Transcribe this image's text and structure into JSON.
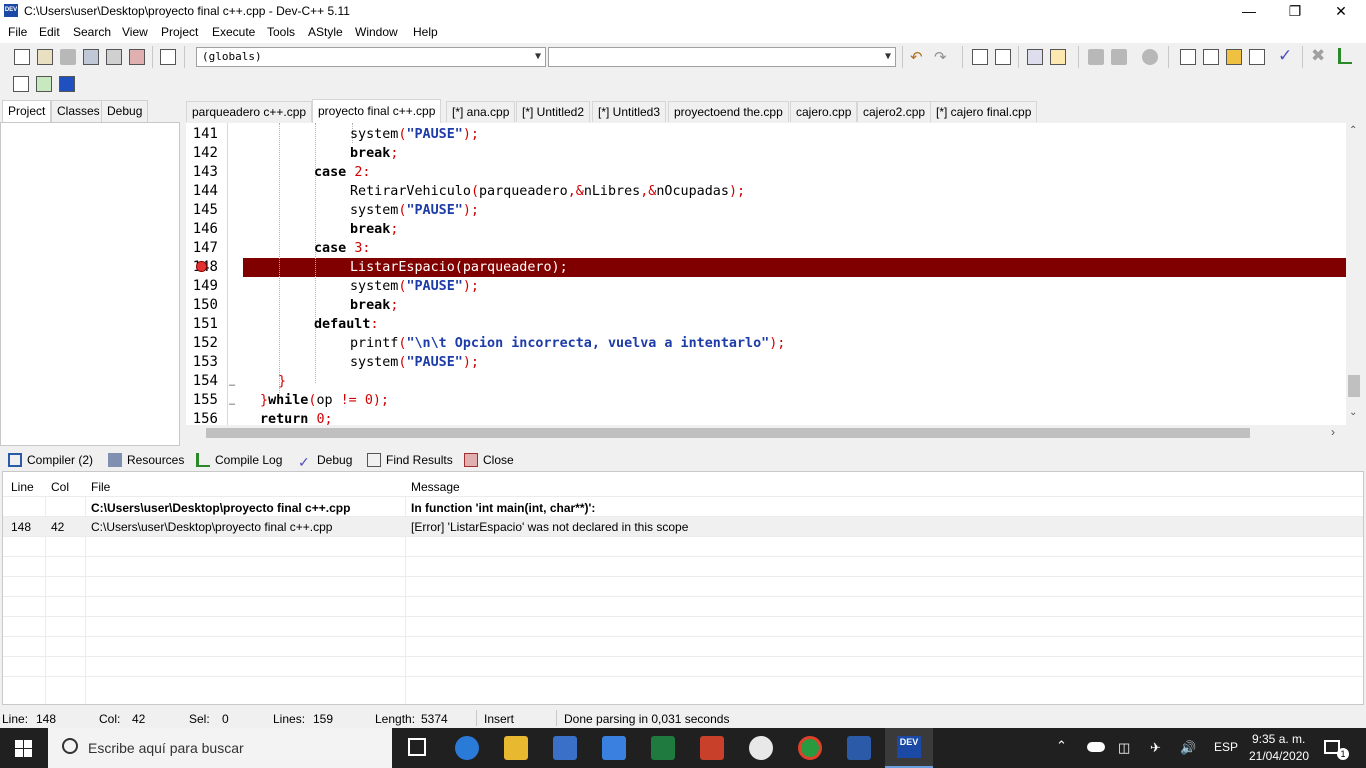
{
  "window": {
    "title": "C:\\Users\\user\\Desktop\\proyecto final c++.cpp - Dev-C++ 5.11",
    "app_icon_text": "DEV",
    "minimize": "—",
    "restore": "❐",
    "close": "✕"
  },
  "menu": [
    "File",
    "Edit",
    "Search",
    "View",
    "Project",
    "Execute",
    "Tools",
    "AStyle",
    "Window",
    "Help"
  ],
  "toolbar": {
    "scope_combo": "(globals)",
    "function_combo": ""
  },
  "left_tabs": [
    "Project",
    "Classes",
    "Debug"
  ],
  "file_tabs": [
    "parqueadero c++.cpp",
    "proyecto final c++.cpp",
    "[*] ana.cpp",
    "[*] Untitled2",
    "[*] Untitled3",
    "proyectoend the.cpp",
    "cajero.cpp",
    "cajero2.cpp",
    "[*] cajero final.cpp"
  ],
  "active_file_tab": 1,
  "editor": {
    "lines": [
      {
        "num": "141",
        "indent": 6,
        "code": [
          [
            "system",
            ""
          ],
          [
            "(",
            "p"
          ],
          [
            "\"PAUSE\"",
            "s"
          ],
          [
            ");",
            "p"
          ]
        ]
      },
      {
        "num": "142",
        "indent": 6,
        "code": [
          [
            "break",
            "k"
          ],
          [
            ";",
            "p"
          ]
        ]
      },
      {
        "num": "143",
        "indent": 4,
        "code": [
          [
            "case ",
            "k"
          ],
          [
            "2",
            "n"
          ],
          [
            ":",
            "p"
          ]
        ]
      },
      {
        "num": "144",
        "indent": 6,
        "code": [
          [
            "RetirarVehiculo",
            ""
          ],
          [
            "(",
            "p"
          ],
          [
            "parqueadero",
            ""
          ],
          [
            ",&",
            "p"
          ],
          [
            "nLibres",
            ""
          ],
          [
            ",&",
            "p"
          ],
          [
            "nOcupadas",
            ""
          ],
          [
            ");",
            "p"
          ]
        ]
      },
      {
        "num": "145",
        "indent": 6,
        "code": [
          [
            "system",
            ""
          ],
          [
            "(",
            "p"
          ],
          [
            "\"PAUSE\"",
            "s"
          ],
          [
            ");",
            "p"
          ]
        ]
      },
      {
        "num": "146",
        "indent": 6,
        "code": [
          [
            "break",
            "k"
          ],
          [
            ";",
            "p"
          ]
        ]
      },
      {
        "num": "147",
        "indent": 4,
        "code": [
          [
            "case ",
            "k"
          ],
          [
            "3",
            "n"
          ],
          [
            ":",
            "p"
          ]
        ]
      },
      {
        "num": "148",
        "indent": 6,
        "error": true,
        "code": [
          [
            "ListarEspacio(parqueadero);",
            ""
          ]
        ]
      },
      {
        "num": "149",
        "indent": 6,
        "code": [
          [
            "system",
            ""
          ],
          [
            "(",
            "p"
          ],
          [
            "\"PAUSE\"",
            "s"
          ],
          [
            ");",
            "p"
          ]
        ]
      },
      {
        "num": "150",
        "indent": 6,
        "code": [
          [
            "break",
            "k"
          ],
          [
            ";",
            "p"
          ]
        ]
      },
      {
        "num": "151",
        "indent": 4,
        "code": [
          [
            "default",
            "k"
          ],
          [
            ":",
            "p"
          ]
        ]
      },
      {
        "num": "152",
        "indent": 6,
        "code": [
          [
            "printf",
            ""
          ],
          [
            "(",
            "p"
          ],
          [
            "\"\\n\\t Opcion incorrecta, vuelva a intentarlo\"",
            "s"
          ],
          [
            ");",
            "p"
          ]
        ]
      },
      {
        "num": "153",
        "indent": 6,
        "code": [
          [
            "system",
            ""
          ],
          [
            "(",
            "p"
          ],
          [
            "\"PAUSE\"",
            "s"
          ],
          [
            ");",
            "p"
          ]
        ]
      },
      {
        "num": "154",
        "indent": 2,
        "code": [
          [
            "}",
            "p"
          ]
        ]
      },
      {
        "num": "155",
        "indent": 1,
        "code": [
          [
            "}",
            "p"
          ],
          [
            "while",
            "k"
          ],
          [
            "(",
            "p"
          ],
          [
            "op ",
            ""
          ],
          [
            "!=",
            "p"
          ],
          [
            " ",
            ""
          ],
          [
            "0",
            "n"
          ],
          [
            ");",
            "p"
          ]
        ]
      },
      {
        "num": "156",
        "indent": 1,
        "code": [
          [
            "return ",
            "k"
          ],
          [
            "0",
            "n"
          ],
          [
            ";",
            "p"
          ]
        ]
      }
    ]
  },
  "bottom_tabs": [
    "Compiler (2)",
    "Resources",
    "Compile Log",
    "Debug",
    "Find Results",
    "Close"
  ],
  "compiler": {
    "headers": {
      "line": "Line",
      "col": "Col",
      "file": "File",
      "message": "Message"
    },
    "rows": [
      {
        "line": "",
        "col": "",
        "file": "C:\\Users\\user\\Desktop\\proyecto final c++.cpp",
        "message": "In function 'int main(int, char**)':",
        "bold": true
      },
      {
        "line": "148",
        "col": "42",
        "file": "C:\\Users\\user\\Desktop\\proyecto final c++.cpp",
        "message": "[Error] 'ListarEspacio' was not declared in this scope",
        "bold": false
      }
    ]
  },
  "status": {
    "line_label": "Line:",
    "line": "148",
    "col_label": "Col:",
    "col": "42",
    "sel_label": "Sel:",
    "sel": "0",
    "lines_label": "Lines:",
    "lines": "159",
    "length_label": "Length:",
    "length": "5374",
    "mode": "Insert",
    "message": "Done parsing in 0,031 seconds"
  },
  "taskbar": {
    "search_placeholder": "Escribe aquí para buscar",
    "lang": "ESP",
    "time": "9:35 a. m.",
    "date": "21/04/2020",
    "notification_count": "1",
    "dev_label": "DEV"
  },
  "colors": {
    "error_line": "#800000",
    "string": "#1e3ca8",
    "number": "#d00000",
    "taskbar": "#202020"
  }
}
